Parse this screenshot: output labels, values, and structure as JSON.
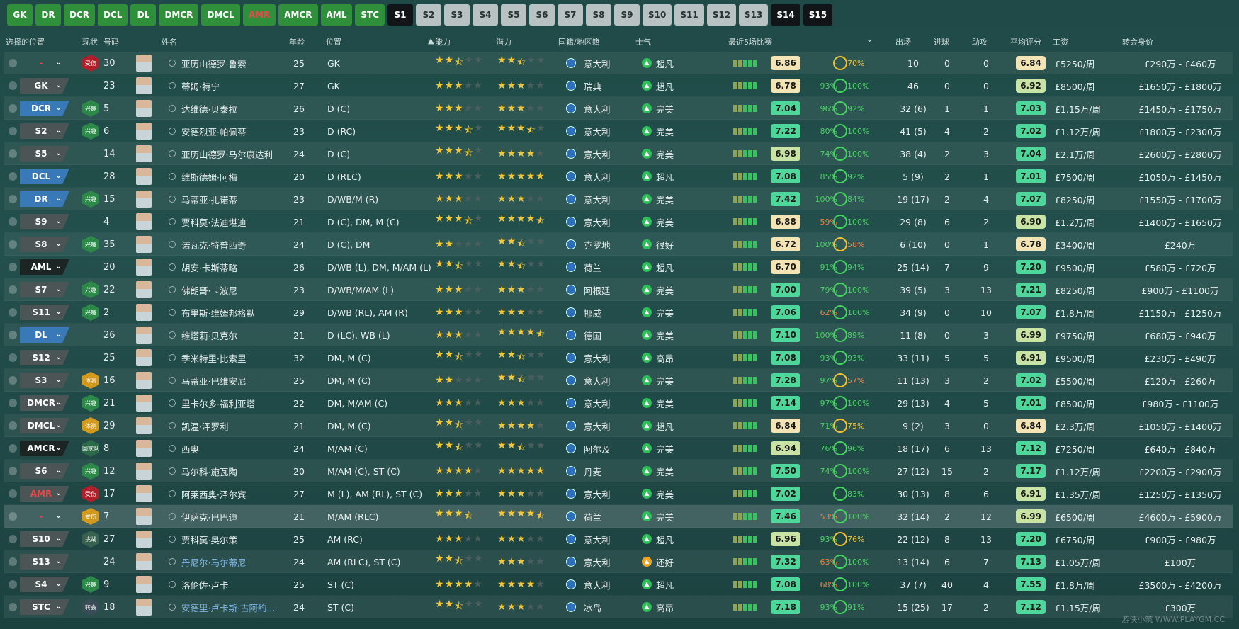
{
  "tabs": [
    {
      "label": "GK",
      "style": "green"
    },
    {
      "label": "DR",
      "style": "green"
    },
    {
      "label": "DCR",
      "style": "green"
    },
    {
      "label": "DCL",
      "style": "green"
    },
    {
      "label": "DL",
      "style": "green"
    },
    {
      "label": "DMCR",
      "style": "green"
    },
    {
      "label": "DMCL",
      "style": "green"
    },
    {
      "label": "AMR",
      "style": "red"
    },
    {
      "label": "AMCR",
      "style": "green"
    },
    {
      "label": "AML",
      "style": "green"
    },
    {
      "label": "STC",
      "style": "green"
    },
    {
      "label": "S1",
      "style": "black"
    },
    {
      "label": "S2",
      "style": "grey"
    },
    {
      "label": "S3",
      "style": "grey"
    },
    {
      "label": "S4",
      "style": "grey"
    },
    {
      "label": "S5",
      "style": "grey"
    },
    {
      "label": "S6",
      "style": "grey"
    },
    {
      "label": "S7",
      "style": "grey"
    },
    {
      "label": "S8",
      "style": "grey"
    },
    {
      "label": "S9",
      "style": "grey"
    },
    {
      "label": "S10",
      "style": "grey"
    },
    {
      "label": "S11",
      "style": "grey"
    },
    {
      "label": "S12",
      "style": "grey"
    },
    {
      "label": "S13",
      "style": "grey"
    },
    {
      "label": "S14",
      "style": "black"
    },
    {
      "label": "S15",
      "style": "black"
    }
  ],
  "columns": {
    "selected_position": "选择的位置",
    "status": "现状",
    "number": "号码",
    "name": "姓名",
    "age": "年龄",
    "position": "位置",
    "ability": "能力",
    "potential": "潜力",
    "nation": "国籍/地区籍",
    "morale": "士气",
    "form": "最近5场比赛",
    "apps": "出场",
    "goals": "进球",
    "assists": "助攻",
    "avg_rating": "平均评分",
    "wage": "工资",
    "value": "转会身价"
  },
  "players": [
    {
      "sel": "-",
      "sel_style": "empty",
      "status": "受伤",
      "status_type": "inj",
      "no": "30",
      "name": "亚历山德罗·鲁索",
      "age": "25",
      "pos": "GK",
      "ab": 2.5,
      "po": 2.5,
      "nation": "意大利",
      "morale": "超凡",
      "rating": "6.86",
      "pct": "-",
      "fit": "70%",
      "apps": "10",
      "goals": "0",
      "assists": "0",
      "avg": "6.84",
      "wage": "£5250/周",
      "value": "£290万 - £460万"
    },
    {
      "sel": "GK",
      "sel_style": "grey",
      "status": "",
      "status_type": "",
      "no": "23",
      "name": "蒂姆·特宁",
      "age": "27",
      "pos": "GK",
      "ab": 3,
      "po": 3,
      "nation": "瑞典",
      "morale": "超凡",
      "rating": "6.78",
      "pct": "93%",
      "fit": "100%",
      "apps": "46",
      "goals": "0",
      "assists": "0",
      "avg": "6.92",
      "wage": "£8500/周",
      "value": "£1650万 - £1800万"
    },
    {
      "sel": "DCR",
      "sel_style": "blue",
      "status": "兴趣",
      "status_type": "int",
      "no": "5",
      "name": "达维德·贝泰拉",
      "age": "26",
      "pos": "D (C)",
      "ab": 3,
      "po": 3,
      "nation": "意大利",
      "morale": "完美",
      "rating": "7.04",
      "pct": "96%",
      "fit": "92%",
      "apps": "32 (6)",
      "goals": "1",
      "assists": "1",
      "avg": "7.03",
      "wage": "£1.15万/周",
      "value": "£1450万 - £1750万"
    },
    {
      "sel": "S2",
      "sel_style": "grey",
      "status": "兴趣",
      "status_type": "int",
      "no": "6",
      "name": "安德烈亚·帕佩蒂",
      "age": "23",
      "pos": "D (RC)",
      "ab": 3.5,
      "po": 3.5,
      "nation": "意大利",
      "morale": "完美",
      "rating": "7.22",
      "pct": "80%",
      "fit": "100%",
      "apps": "41 (5)",
      "goals": "4",
      "assists": "2",
      "avg": "7.02",
      "wage": "£1.12万/周",
      "value": "£1800万 - £2300万"
    },
    {
      "sel": "S5",
      "sel_style": "grey",
      "status": "",
      "status_type": "",
      "no": "14",
      "name": "亚历山德罗·马尔康达利",
      "age": "24",
      "pos": "D (C)",
      "ab": 3.5,
      "po": 4,
      "nation": "意大利",
      "morale": "完美",
      "rating": "6.98",
      "pct": "74%",
      "fit": "100%",
      "apps": "38 (4)",
      "goals": "2",
      "assists": "3",
      "avg": "7.04",
      "wage": "£2.1万/周",
      "value": "£2600万 - £2800万"
    },
    {
      "sel": "DCL",
      "sel_style": "blue",
      "status": "",
      "status_type": "",
      "no": "28",
      "name": "维斯德姆·阿梅",
      "age": "20",
      "pos": "D (RLC)",
      "ab": 3,
      "po": 5,
      "nation": "意大利",
      "morale": "超凡",
      "rating": "7.08",
      "pct": "85%",
      "fit": "92%",
      "apps": "5 (9)",
      "goals": "2",
      "assists": "1",
      "avg": "7.01",
      "wage": "£7500/周",
      "value": "£1050万 - £1450万"
    },
    {
      "sel": "DR",
      "sel_style": "blue",
      "status": "兴趣",
      "status_type": "int",
      "no": "15",
      "name": "马蒂亚·扎诺蒂",
      "age": "23",
      "pos": "D/WB/M (R)",
      "ab": 3,
      "po": 3,
      "nation": "意大利",
      "morale": "完美",
      "rating": "7.42",
      "pct": "100%",
      "fit": "84%",
      "apps": "19 (17)",
      "goals": "2",
      "assists": "4",
      "avg": "7.07",
      "wage": "£8250/周",
      "value": "£1550万 - £1700万"
    },
    {
      "sel": "S9",
      "sel_style": "grey",
      "status": "",
      "status_type": "",
      "no": "4",
      "name": "贾科莫·法迪堪迪",
      "age": "21",
      "pos": "D (C), DM, M (C)",
      "ab": 3.5,
      "po": 4.5,
      "nation": "意大利",
      "morale": "完美",
      "rating": "6.88",
      "pct": "59%",
      "fit": "100%",
      "apps": "29 (8)",
      "goals": "6",
      "assists": "2",
      "avg": "6.90",
      "wage": "£1.2万/周",
      "value": "£1400万 - £1650万"
    },
    {
      "sel": "S8",
      "sel_style": "grey",
      "status": "兴趣",
      "status_type": "int",
      "no": "35",
      "name": "诺瓦克·特普西奇",
      "age": "24",
      "pos": "D (C), DM",
      "ab": 2,
      "po": 2.5,
      "nation": "克罗地",
      "morale": "很好",
      "rating": "6.72",
      "pct": "100%",
      "fit": "58%",
      "apps": "6 (10)",
      "goals": "0",
      "assists": "1",
      "avg": "6.78",
      "wage": "£3400/周",
      "value": "£240万"
    },
    {
      "sel": "AML",
      "sel_style": "dark",
      "status": "",
      "status_type": "",
      "no": "20",
      "name": "胡安·卡斯蒂略",
      "age": "26",
      "pos": "D/WB (L), DM, M/AM (L)",
      "ab": 2.5,
      "po": 2.5,
      "nation": "荷兰",
      "morale": "超凡",
      "rating": "6.70",
      "pct": "91%",
      "fit": "94%",
      "apps": "25 (14)",
      "goals": "7",
      "assists": "9",
      "avg": "7.20",
      "wage": "£9500/周",
      "value": "£580万 - £720万"
    },
    {
      "sel": "S7",
      "sel_style": "grey",
      "status": "兴趣",
      "status_type": "int",
      "no": "22",
      "name": "佛朗哥·卡波尼",
      "age": "23",
      "pos": "D/WB/M/AM (L)",
      "ab": 3,
      "po": 3,
      "nation": "阿根廷",
      "morale": "完美",
      "rating": "7.00",
      "pct": "79%",
      "fit": "100%",
      "apps": "39 (5)",
      "goals": "3",
      "assists": "13",
      "avg": "7.21",
      "wage": "£8250/周",
      "value": "£900万 - £1100万"
    },
    {
      "sel": "S11",
      "sel_style": "grey",
      "status": "兴趣",
      "status_type": "int",
      "no": "2",
      "name": "布里斯·维姆邦格默",
      "age": "29",
      "pos": "D/WB (RL), AM (R)",
      "ab": 3,
      "po": 3,
      "nation": "挪威",
      "morale": "完美",
      "rating": "7.06",
      "pct": "62%",
      "fit": "100%",
      "apps": "34 (9)",
      "goals": "0",
      "assists": "10",
      "avg": "7.07",
      "wage": "£1.8万/周",
      "value": "£1150万 - £1250万"
    },
    {
      "sel": "DL",
      "sel_style": "blue",
      "status": "",
      "status_type": "",
      "no": "26",
      "name": "维塔莉·贝克尔",
      "age": "21",
      "pos": "D (LC), WB (L)",
      "ab": 3,
      "po": 4.5,
      "nation": "德国",
      "morale": "完美",
      "rating": "7.10",
      "pct": "100%",
      "fit": "89%",
      "apps": "11 (8)",
      "goals": "0",
      "assists": "3",
      "avg": "6.99",
      "wage": "£9750/周",
      "value": "£680万 - £940万"
    },
    {
      "sel": "S12",
      "sel_style": "grey",
      "status": "",
      "status_type": "",
      "no": "25",
      "name": "季米特里·比索里",
      "age": "32",
      "pos": "DM, M (C)",
      "ab": 2.5,
      "po": 2.5,
      "nation": "意大利",
      "morale": "高昂",
      "rating": "7.08",
      "pct": "93%",
      "fit": "93%",
      "apps": "33 (11)",
      "goals": "5",
      "assists": "5",
      "avg": "6.91",
      "wage": "£9500/周",
      "value": "£230万 - £490万"
    },
    {
      "sel": "S3",
      "sel_style": "grey",
      "status": "体测",
      "status_type": "fit",
      "no": "16",
      "name": "马蒂亚·巴维安尼",
      "age": "25",
      "pos": "DM, M (C)",
      "ab": 2,
      "po": 2.5,
      "nation": "意大利",
      "morale": "完美",
      "rating": "7.28",
      "pct": "97%",
      "fit": "57%",
      "apps": "11 (13)",
      "goals": "3",
      "assists": "2",
      "avg": "7.02",
      "wage": "£5500/周",
      "value": "£120万 - £260万"
    },
    {
      "sel": "DMCR",
      "sel_style": "grey",
      "status": "兴趣",
      "status_type": "int",
      "no": "21",
      "name": "里卡尔多·福利亚塔",
      "age": "22",
      "pos": "DM, M/AM (C)",
      "ab": 3,
      "po": 3,
      "nation": "意大利",
      "morale": "完美",
      "rating": "7.14",
      "pct": "97%",
      "fit": "100%",
      "apps": "29 (13)",
      "goals": "4",
      "assists": "5",
      "avg": "7.01",
      "wage": "£8500/周",
      "value": "£980万 - £1100万"
    },
    {
      "sel": "DMCL",
      "sel_style": "grey",
      "status": "体测",
      "status_type": "fit",
      "no": "29",
      "name": "凯温·泽罗利",
      "age": "21",
      "pos": "DM, M (C)",
      "ab": 2.5,
      "po": 4,
      "nation": "意大利",
      "morale": "超凡",
      "rating": "6.84",
      "pct": "71%",
      "fit": "75%",
      "apps": "9 (2)",
      "goals": "3",
      "assists": "0",
      "avg": "6.84",
      "wage": "£2.3万/周",
      "value": "£1050万 - £1400万"
    },
    {
      "sel": "AMCR",
      "sel_style": "dark",
      "status": "国家队",
      "status_type": "nat",
      "no": "8",
      "name": "西奥",
      "age": "24",
      "pos": "M/AM (C)",
      "ab": 2.5,
      "po": 2.5,
      "nation": "阿尔及",
      "morale": "完美",
      "rating": "6.94",
      "pct": "76%",
      "fit": "96%",
      "apps": "18 (17)",
      "goals": "6",
      "assists": "13",
      "avg": "7.12",
      "wage": "£7250/周",
      "value": "£640万 - £840万"
    },
    {
      "sel": "S6",
      "sel_style": "grey",
      "status": "兴趣",
      "status_type": "int",
      "no": "12",
      "name": "马尔科·施瓦陶",
      "age": "20",
      "pos": "M/AM (C), ST (C)",
      "ab": 4,
      "po": 5,
      "nation": "丹麦",
      "morale": "完美",
      "rating": "7.50",
      "pct": "74%",
      "fit": "100%",
      "apps": "27 (12)",
      "goals": "15",
      "assists": "2",
      "avg": "7.17",
      "wage": "£1.12万/周",
      "value": "£2200万 - £2900万"
    },
    {
      "sel": "AMR",
      "sel_style": "red",
      "status": "受伤",
      "status_type": "inj",
      "no": "17",
      "name": "阿莱西奥·泽尔宾",
      "age": "27",
      "pos": "M (L), AM (RL), ST (C)",
      "ab": 3,
      "po": 3,
      "nation": "意大利",
      "morale": "完美",
      "rating": "7.02",
      "pct": "-",
      "fit": "83%",
      "apps": "30 (13)",
      "goals": "8",
      "assists": "6",
      "avg": "6.91",
      "wage": "£1.35万/周",
      "value": "£1250万 - £1350万"
    },
    {
      "sel": "-",
      "sel_style": "empty",
      "status": "受伤",
      "status_type": "fit",
      "no": "7",
      "name": "伊萨克·巴巴迪",
      "age": "21",
      "pos": "M/AM (RLC)",
      "ab": 3.5,
      "po": 4.5,
      "nation": "荷兰",
      "morale": "完美",
      "rating": "7.46",
      "pct": "53%",
      "fit": "100%",
      "apps": "32 (14)",
      "goals": "2",
      "assists": "12",
      "avg": "6.99",
      "wage": "£6500/周",
      "value": "£4600万 - £5900万",
      "hl": true
    },
    {
      "sel": "S10",
      "sel_style": "grey",
      "status": "挑战",
      "status_type": "chal",
      "no": "27",
      "name": "贾科莫·奥尔策",
      "age": "25",
      "pos": "AM (RC)",
      "ab": 3,
      "po": 3,
      "nation": "意大利",
      "morale": "超凡",
      "rating": "6.96",
      "pct": "93%",
      "fit": "76%",
      "apps": "22 (12)",
      "goals": "8",
      "assists": "13",
      "avg": "7.20",
      "wage": "£6750/周",
      "value": "£900万 - £980万"
    },
    {
      "sel": "S13",
      "sel_style": "grey",
      "status": "",
      "status_type": "",
      "no": "24",
      "name": "丹尼尔·马尔蒂尼",
      "age": "24",
      "pos": "AM (RLC), ST (C)",
      "ab": 2.5,
      "po": 3,
      "nation": "意大利",
      "morale": "还好",
      "rating": "7.32",
      "pct": "63%",
      "fit": "100%",
      "apps": "13 (14)",
      "goals": "6",
      "assists": "7",
      "avg": "7.13",
      "wage": "£1.05万/周",
      "value": "£100万",
      "link": true
    },
    {
      "sel": "S4",
      "sel_style": "grey",
      "status": "兴趣",
      "status_type": "int",
      "no": "9",
      "name": "洛伦佐·卢卡",
      "age": "25",
      "pos": "ST (C)",
      "ab": 4,
      "po": 4,
      "nation": "意大利",
      "morale": "超凡",
      "rating": "7.08",
      "pct": "68%",
      "fit": "100%",
      "apps": "37 (7)",
      "goals": "40",
      "assists": "4",
      "avg": "7.55",
      "wage": "£1.8万/周",
      "value": "£3500万 - £4200万"
    },
    {
      "sel": "STC",
      "sel_style": "grey",
      "status": "转会",
      "status_type": "trans",
      "no": "18",
      "name": "安德里·卢卡斯·古阿约...",
      "age": "24",
      "pos": "ST (C)",
      "ab": 2.5,
      "po": 3,
      "nation": "冰岛",
      "morale": "高昂",
      "rating": "7.18",
      "pct": "93%",
      "fit": "91%",
      "apps": "15 (25)",
      "goals": "17",
      "assists": "2",
      "avg": "7.12",
      "wage": "£1.15万/周",
      "value": "£300万",
      "link": true
    }
  ],
  "watermark": "游侠小筑 WWW.PLAYGM.CC"
}
